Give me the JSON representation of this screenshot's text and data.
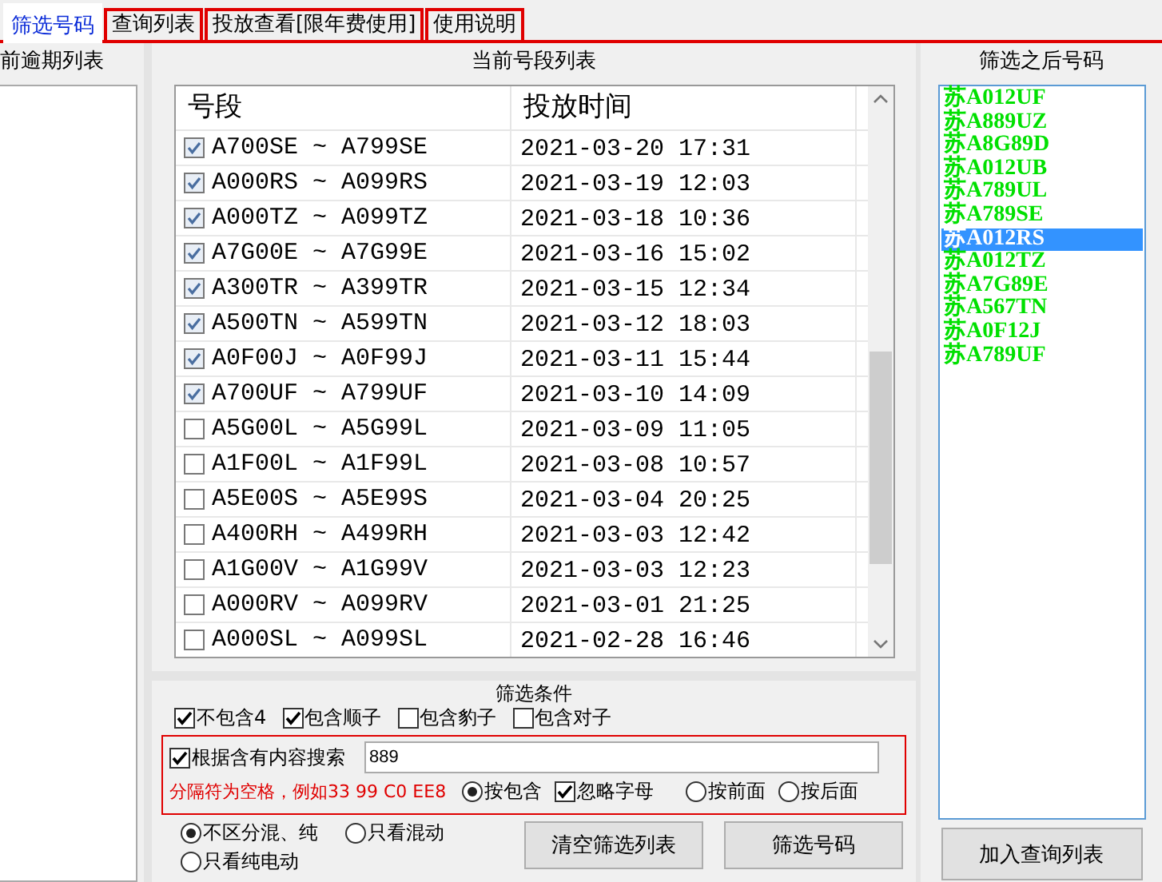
{
  "tabs": [
    {
      "label": "筛选号码",
      "selected": true
    },
    {
      "label": "查询列表",
      "selected": false
    },
    {
      "label": "投放查看[限年费使用]",
      "selected": false
    },
    {
      "label": "使用说明",
      "selected": false
    }
  ],
  "overdue_panel": {
    "title": "前逾期列表"
  },
  "segment_list": {
    "title": "当前号段列表",
    "columns": [
      "号段",
      "投放时间"
    ],
    "rows": [
      {
        "range": "A700SE ~ A799SE",
        "time": "2021-03-20 17:31",
        "checked": true
      },
      {
        "range": "A000RS ~ A099RS",
        "time": "2021-03-19 12:03",
        "checked": true
      },
      {
        "range": "A000TZ ~ A099TZ",
        "time": "2021-03-18 10:36",
        "checked": true
      },
      {
        "range": "A7G00E ~ A7G99E",
        "time": "2021-03-16 15:02",
        "checked": true
      },
      {
        "range": "A300TR ~ A399TR",
        "time": "2021-03-15 12:34",
        "checked": true
      },
      {
        "range": "A500TN ~ A599TN",
        "time": "2021-03-12 18:03",
        "checked": true
      },
      {
        "range": "A0F00J ~ A0F99J",
        "time": "2021-03-11 15:44",
        "checked": true
      },
      {
        "range": "A700UF ~ A799UF",
        "time": "2021-03-10 14:09",
        "checked": true
      },
      {
        "range": "A5G00L ~ A5G99L",
        "time": "2021-03-09 11:05",
        "checked": false
      },
      {
        "range": "A1F00L ~ A1F99L",
        "time": "2021-03-08 10:57",
        "checked": false
      },
      {
        "range": "A5E00S ~ A5E99S",
        "time": "2021-03-04 20:25",
        "checked": false
      },
      {
        "range": "A400RH ~ A499RH",
        "time": "2021-03-03 12:42",
        "checked": false
      },
      {
        "range": "A1G00V ~ A1G99V",
        "time": "2021-03-03 12:23",
        "checked": false
      },
      {
        "range": "A000RV ~ A099RV",
        "time": "2021-03-01 21:25",
        "checked": false
      },
      {
        "range": "A000SL ~ A099SL",
        "time": "2021-02-28 16:46",
        "checked": false
      }
    ]
  },
  "result_panel": {
    "title": "筛选之后号码",
    "items": [
      {
        "text": "苏A012UF",
        "selected": false
      },
      {
        "text": "苏A889UZ",
        "selected": false
      },
      {
        "text": "苏A8G89D",
        "selected": false
      },
      {
        "text": "苏A012UB",
        "selected": false
      },
      {
        "text": "苏A789UL",
        "selected": false
      },
      {
        "text": "苏A789SE",
        "selected": false
      },
      {
        "text": "苏A012RS",
        "selected": true
      },
      {
        "text": "苏A012TZ",
        "selected": false
      },
      {
        "text": "苏A7G89E",
        "selected": false
      },
      {
        "text": "苏A567TN",
        "selected": false
      },
      {
        "text": "苏A0F12J",
        "selected": false
      },
      {
        "text": "苏A789UF",
        "selected": false
      }
    ],
    "button": "加入查询列表"
  },
  "filter": {
    "title": "筛选条件",
    "options": [
      {
        "label": "不包含4",
        "checked": true
      },
      {
        "label": "包含顺子",
        "checked": true
      },
      {
        "label": "包含豹子",
        "checked": false
      },
      {
        "label": "包含对子",
        "checked": false
      }
    ],
    "search": {
      "label": "根据含有内容搜索",
      "checked": true,
      "value": "889",
      "hint": "分隔符为空格，例如33 99 C0 EE8",
      "modes": [
        {
          "kind": "radio",
          "label": "按包含",
          "selected": true
        },
        {
          "kind": "checkbox",
          "label": "忽略字母",
          "checked": true
        },
        {
          "kind": "radio",
          "label": "按前面",
          "selected": false
        },
        {
          "kind": "radio",
          "label": "按后面",
          "selected": false
        }
      ]
    },
    "power_types": [
      {
        "label": "不区分混、纯",
        "selected": true
      },
      {
        "label": "只看混动",
        "selected": false
      },
      {
        "label": "只看纯电动",
        "selected": false
      }
    ],
    "buttons": [
      "清空筛选列表",
      "筛选号码"
    ]
  }
}
